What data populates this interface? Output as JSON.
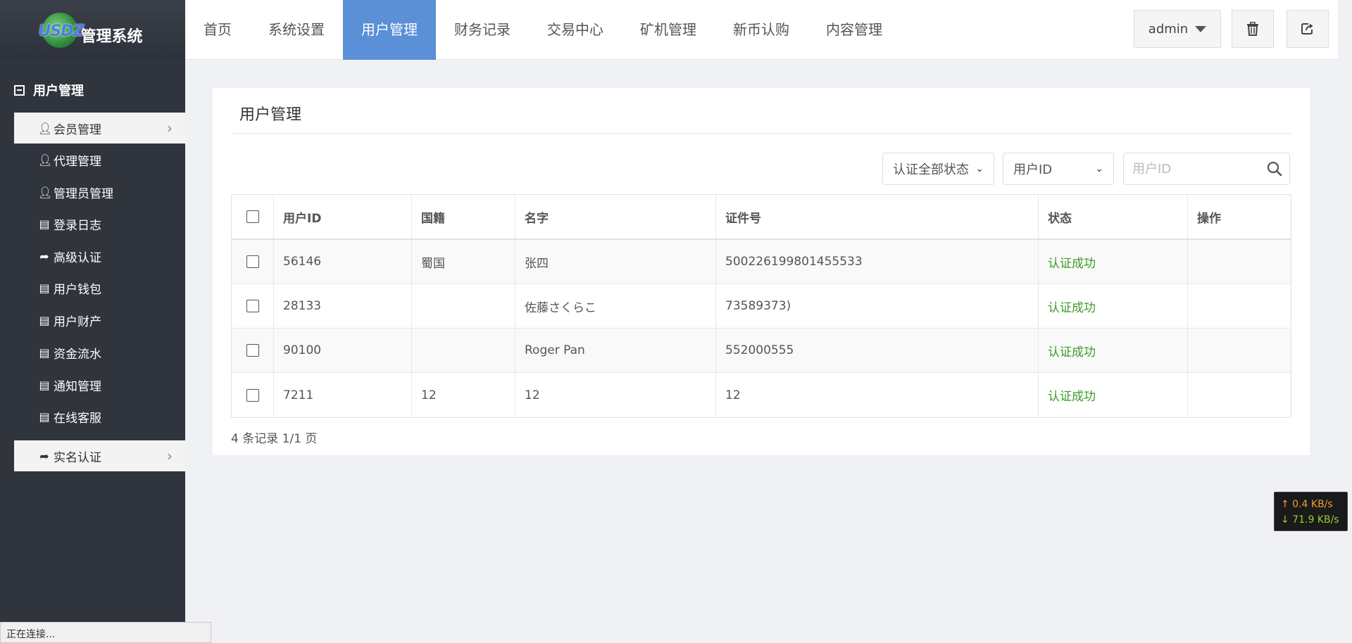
{
  "logo": {
    "mark": "USDZ",
    "text": "管理系统"
  },
  "nav": [
    {
      "label": "首页",
      "active": false
    },
    {
      "label": "系统设置",
      "active": false
    },
    {
      "label": "用户管理",
      "active": true
    },
    {
      "label": "财务记录",
      "active": false
    },
    {
      "label": "交易中心",
      "active": false
    },
    {
      "label": "矿机管理",
      "active": false
    },
    {
      "label": "新币认购",
      "active": false
    },
    {
      "label": "内容管理",
      "active": false
    }
  ],
  "header": {
    "user": "admin"
  },
  "sidebar": {
    "title": "用户管理",
    "items": [
      {
        "label": "会员管理",
        "icon": "user-icon"
      },
      {
        "label": "代理管理",
        "icon": "user-icon"
      },
      {
        "label": "管理员管理",
        "icon": "user-icon"
      },
      {
        "label": "登录日志",
        "icon": "list-icon"
      },
      {
        "label": "高级认证",
        "icon": "share-icon"
      },
      {
        "label": "用户钱包",
        "icon": "list-icon"
      },
      {
        "label": "用户财产",
        "icon": "list-icon"
      },
      {
        "label": "资金流水",
        "icon": "list-icon"
      },
      {
        "label": "通知管理",
        "icon": "list-icon"
      },
      {
        "label": "在线客服",
        "icon": "list-icon"
      },
      {
        "label": "实名认证",
        "icon": "share-icon"
      }
    ]
  },
  "main": {
    "title": "用户管理",
    "filters": {
      "status_select": "认证全部状态",
      "field_select": "用户ID",
      "search_placeholder": "用户ID"
    },
    "columns": [
      "用户ID",
      "国籍",
      "名字",
      "证件号",
      "状态",
      "操作"
    ],
    "rows": [
      {
        "id": "56146",
        "nationality": "蜀国",
        "name": "张四",
        "doc": "500226199801455533",
        "status": "认证成功",
        "action": ""
      },
      {
        "id": "28133",
        "nationality": "",
        "name": "佐藤さくらこ",
        "doc": "73589373)",
        "status": "认证成功",
        "action": ""
      },
      {
        "id": "90100",
        "nationality": "",
        "name": "Roger Pan",
        "doc": "552000555",
        "status": "认证成功",
        "action": ""
      },
      {
        "id": "7211",
        "nationality": "12",
        "name": "12",
        "doc": "12",
        "status": "认证成功",
        "action": ""
      }
    ],
    "summary": "4 条记录 1/1 页"
  },
  "statusbar": "正在连接...",
  "net_speed": {
    "up": "↑ 0.4 KB/s",
    "down": "↓ 71.9 KB/s"
  },
  "colors": {
    "accent": "#5b8fd6",
    "sidebar": "#2f343d",
    "success": "#3c9a2a"
  }
}
